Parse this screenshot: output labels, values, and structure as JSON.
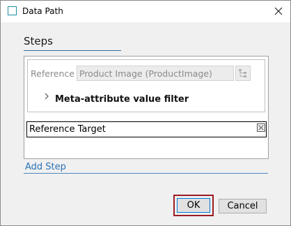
{
  "window": {
    "title": "Data Path",
    "icon": "app-square-icon",
    "close_icon": "close-icon"
  },
  "steps": {
    "heading": "Steps",
    "reference_label": "Reference",
    "reference_value": "Product Image (ProductImage)",
    "reference_picker_icon": "tree-picker-icon",
    "meta_filter_label": "Meta-attribute value filter",
    "meta_filter_expanded": false,
    "reference_target_label": "Reference Target",
    "reference_target_remove_icon": "remove-icon"
  },
  "add_step_label": "Add Step",
  "buttons": {
    "ok": "OK",
    "cancel": "Cancel"
  },
  "colors": {
    "accent_link": "#2a72b5",
    "ok_focus_outline": "#9b1b22",
    "app_icon": "#1f8fa3"
  }
}
